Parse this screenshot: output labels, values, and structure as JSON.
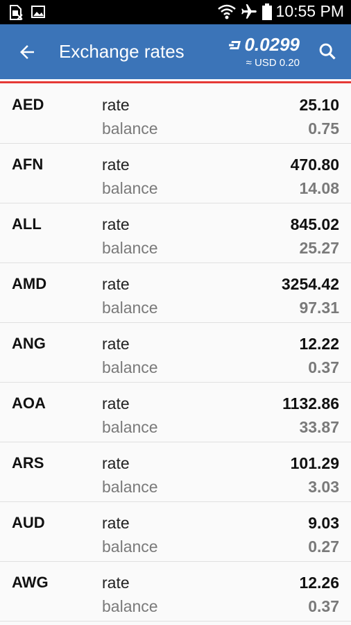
{
  "status_bar": {
    "time": "10:55 PM",
    "icons": [
      "no-sim-icon",
      "image-icon",
      "wifi-icon",
      "airplane-icon",
      "battery-icon"
    ]
  },
  "app_bar": {
    "title": "Exchange rates",
    "balance": "0.0299",
    "balance_fiat": "≈ USD 0.20",
    "background_color": "#3b74b8",
    "accent_color": "#e53935"
  },
  "labels": {
    "rate": "rate",
    "balance": "balance"
  },
  "rates": [
    {
      "code": "AED",
      "rate": "25.10",
      "balance": "0.75"
    },
    {
      "code": "AFN",
      "rate": "470.80",
      "balance": "14.08"
    },
    {
      "code": "ALL",
      "rate": "845.02",
      "balance": "25.27"
    },
    {
      "code": "AMD",
      "rate": "3254.42",
      "balance": "97.31"
    },
    {
      "code": "ANG",
      "rate": "12.22",
      "balance": "0.37"
    },
    {
      "code": "AOA",
      "rate": "1132.86",
      "balance": "33.87"
    },
    {
      "code": "ARS",
      "rate": "101.29",
      "balance": "3.03"
    },
    {
      "code": "AUD",
      "rate": "9.03",
      "balance": "0.27"
    },
    {
      "code": "AWG",
      "rate": "12.26",
      "balance": "0.37"
    }
  ]
}
